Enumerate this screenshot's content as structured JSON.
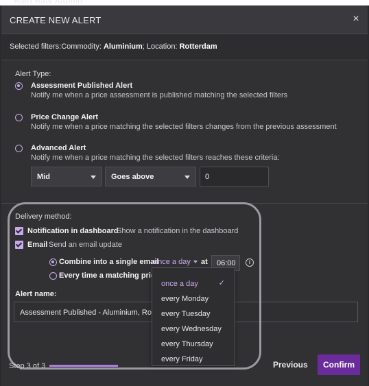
{
  "background_text": "Alert Rate Alumin",
  "modal": {
    "title": "CREATE NEW ALERT",
    "close_label": "×"
  },
  "filters": {
    "prefix": "Selected filters:Commodity: ",
    "commodity": "Aluminium",
    "location_prefix": "; Location: ",
    "location": "Rotterdam"
  },
  "alert_type": {
    "label": "Alert Type:",
    "options": [
      {
        "title": "Assessment Published Alert",
        "desc": "Notify me when a price assessment is published matching the selected filters",
        "selected": true
      },
      {
        "title": "Price Change Alert",
        "desc": "Notify me when a price matching the selected filters changes from the previous assessment",
        "selected": false
      },
      {
        "title": "Advanced Alert",
        "desc": "Notify me when a price matching the selected filters reaches these criteria:",
        "selected": false
      }
    ],
    "criteria": {
      "field": "Mid",
      "operator": "Goes above",
      "value": "0"
    }
  },
  "delivery": {
    "label": "Delivery method:",
    "dashboard": {
      "title": "Notification in dashboard",
      "desc": "Show a notification in the dashboard",
      "checked": true
    },
    "email": {
      "title": "Email",
      "desc": "Send an email update",
      "checked": true
    },
    "combine_label": "Combine into a single email",
    "frequency": "once a day",
    "at_label": "at",
    "time": "06:00",
    "every_time_label": "Every time a matching price"
  },
  "alert_name": {
    "label": "Alert name:",
    "value": "Assessment Published - Aluminium, Rotte"
  },
  "frequency_options": [
    "once a day",
    "every Monday",
    "every Tuesday",
    "every Wednesday",
    "every Thursday",
    "every Friday"
  ],
  "footer": {
    "step": "Step 3 of 3",
    "previous": "Previous",
    "confirm": "Confirm"
  },
  "colors": {
    "accent": "#c9a7ec",
    "confirm_bg": "#6a2c9a",
    "modal_bg": "#313134"
  }
}
